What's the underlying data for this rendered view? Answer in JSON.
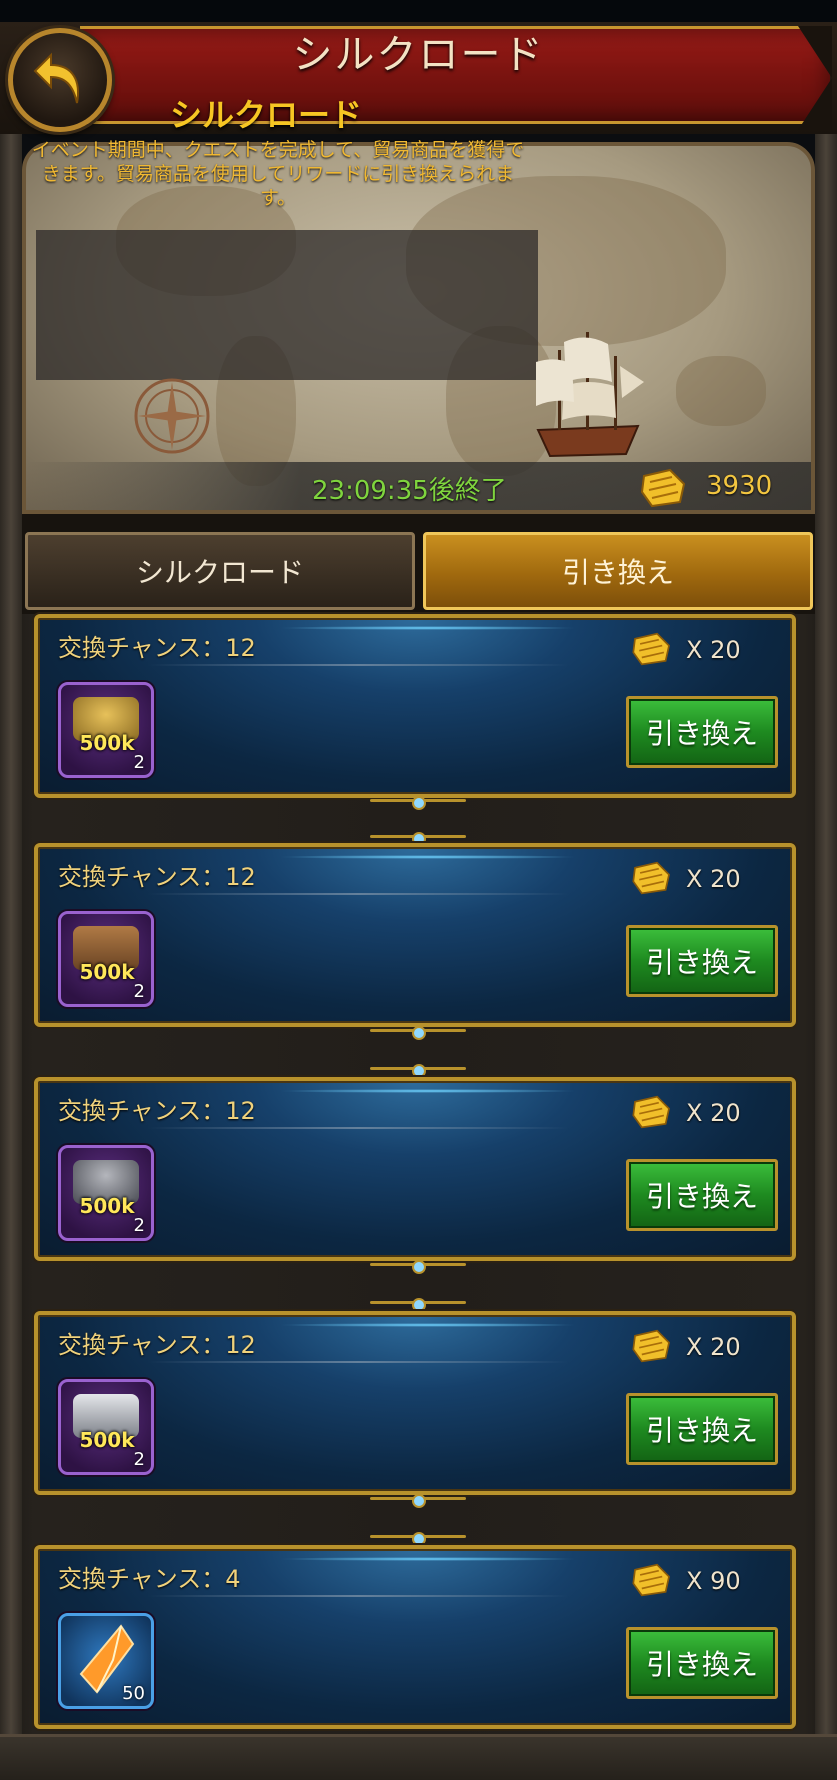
{
  "header": {
    "title": "シルクロード",
    "back_icon": "back-arrow-icon"
  },
  "banner": {
    "title": "シルクロード",
    "description": "イベント期間中、クエストを完成して、貿易商品を獲得できます。貿易商品を使用してリワードに引き換えられます。",
    "timer": "23:09:35後終了",
    "currency_icon": "trade-goods-icon",
    "currency_value": "3930"
  },
  "tabs": [
    {
      "label": "シルクロード",
      "active": false
    },
    {
      "label": "引き換え",
      "active": true
    }
  ],
  "items": [
    {
      "chance": "交換チャンス：12",
      "cost": "X 20",
      "amount": "500k",
      "qty": "2",
      "icon": "food-icon",
      "redeem": "引き換え"
    },
    {
      "chance": "交換チャンス：12",
      "cost": "X 20",
      "amount": "500k",
      "qty": "2",
      "icon": "wood-icon",
      "redeem": "引き換え"
    },
    {
      "chance": "交換チャンス：12",
      "cost": "X 20",
      "amount": "500k",
      "qty": "2",
      "icon": "stone-icon",
      "redeem": "引き換え"
    },
    {
      "chance": "交換チャンス：12",
      "cost": "X 20",
      "amount": "500k",
      "qty": "2",
      "icon": "iron-icon",
      "redeem": "引き換え"
    },
    {
      "chance": "交換チャンス：4",
      "cost": "X 90",
      "amount": "",
      "qty": "50",
      "icon": "crystal-icon",
      "redeem": "引き換え"
    }
  ],
  "colors": {
    "header_red": "#7d1410",
    "gold": "#b8922c",
    "green_button": "#1e8a20",
    "timer_green": "#7fd43e",
    "text_gold": "#f0d27c"
  }
}
